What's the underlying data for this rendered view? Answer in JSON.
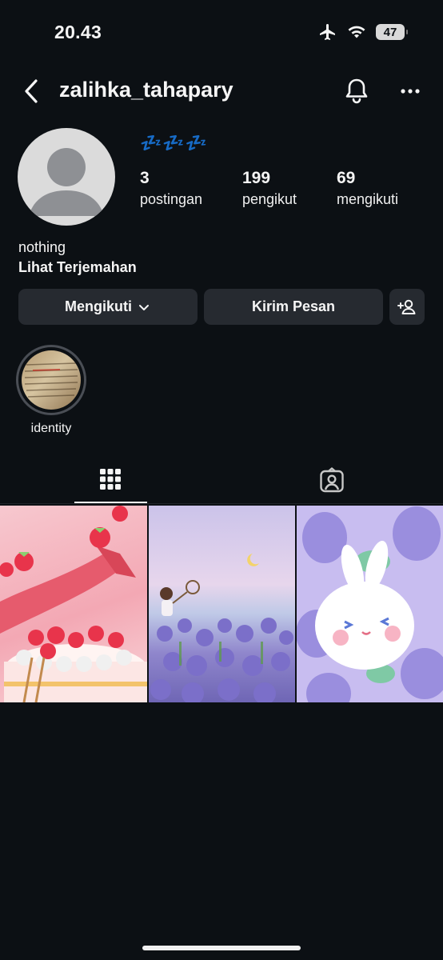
{
  "status_bar": {
    "time": "20.43",
    "battery": "47"
  },
  "header": {
    "username": "zalihka_tahapary"
  },
  "profile": {
    "display_name": "💤💤💤",
    "stats": [
      {
        "value": "3",
        "label": "postingan"
      },
      {
        "value": "199",
        "label": "pengikut"
      },
      {
        "value": "69",
        "label": "mengikuti"
      }
    ],
    "bio": "nothing",
    "translate_link": "Lihat Terjemahan"
  },
  "actions": {
    "following_label": "Mengikuti",
    "message_label": "Kirim Pesan"
  },
  "highlights": [
    {
      "label": "identity"
    }
  ],
  "tabs": {
    "active": "grid"
  },
  "colors": {
    "background": "#0c1014",
    "button": "#262a30",
    "accent": "#3f7ee6"
  }
}
